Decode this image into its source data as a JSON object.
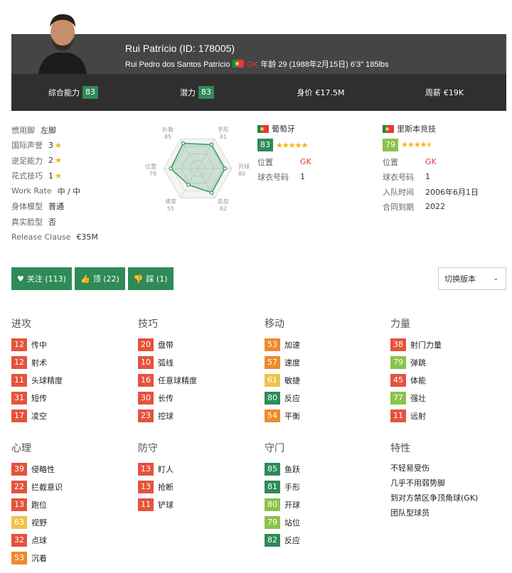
{
  "player": {
    "name": "Rui Patrício (ID: 178005)",
    "full_name": "Rui Pedro dos Santos Patrício",
    "position": "GK",
    "age_info": "年龄 29 (1988年2月15日) 6'3\" 185lbs"
  },
  "summary": [
    {
      "label": "综合能力",
      "value": "83"
    },
    {
      "label": "潜力",
      "value": "83"
    },
    {
      "label": "身价",
      "value": "€17.5M"
    },
    {
      "label": "周薪",
      "value": "€19K"
    }
  ],
  "info": [
    {
      "label": "惯用脚",
      "value": "左脚"
    },
    {
      "label": "国际声誉",
      "value": "3"
    },
    {
      "label": "逆足能力",
      "value": "2"
    },
    {
      "label": "花式技巧",
      "value": "1"
    },
    {
      "label": "Work Rate",
      "value": "中 / 中"
    },
    {
      "label": "身体模型",
      "value": "普通"
    },
    {
      "label": "真实脸型",
      "value": "否"
    },
    {
      "label": "Release Clause",
      "value": "€35M"
    }
  ],
  "radar": [
    {
      "label": "扑救",
      "value": "85"
    },
    {
      "label": "手形",
      "value": "81"
    },
    {
      "label": "开球",
      "value": "80"
    },
    {
      "label": "反应",
      "value": "82"
    },
    {
      "label": "速度",
      "value": "55"
    },
    {
      "label": "位置",
      "value": "79"
    }
  ],
  "national": {
    "name": "葡萄牙",
    "rating": "83",
    "stars": "★★★★★",
    "position_label": "位置",
    "position": "GK",
    "jersey_label": "球衣号码",
    "jersey": "1"
  },
  "club": {
    "name": "里斯本竞技",
    "rating": "79",
    "stars": "★★★★⯨",
    "position_label": "位置",
    "position": "GK",
    "jersey_label": "球衣号码",
    "jersey": "1",
    "joined_label": "入队时间",
    "joined": "2006年6月1日",
    "contract_label": "合同到期",
    "contract": "2022"
  },
  "buttons": {
    "follow": "关注 (113)",
    "like": "顶 (22)",
    "dislike": "踩 (1)",
    "version": "切换版本"
  },
  "attributes": [
    {
      "title": "进攻",
      "items": [
        {
          "v": "12",
          "n": "传中",
          "c": "r"
        },
        {
          "v": "12",
          "n": "射术",
          "c": "r"
        },
        {
          "v": "11",
          "n": "头球精度",
          "c": "r"
        },
        {
          "v": "31",
          "n": "短传",
          "c": "r"
        },
        {
          "v": "17",
          "n": "凌空",
          "c": "r"
        }
      ]
    },
    {
      "title": "技巧",
      "items": [
        {
          "v": "20",
          "n": "盘带",
          "c": "r"
        },
        {
          "v": "10",
          "n": "弧线",
          "c": "r"
        },
        {
          "v": "16",
          "n": "任意球精度",
          "c": "r"
        },
        {
          "v": "30",
          "n": "长传",
          "c": "r"
        },
        {
          "v": "23",
          "n": "控球",
          "c": "r"
        }
      ]
    },
    {
      "title": "移动",
      "items": [
        {
          "v": "53",
          "n": "加速",
          "c": "o"
        },
        {
          "v": "57",
          "n": "速度",
          "c": "o"
        },
        {
          "v": "61",
          "n": "敏捷",
          "c": "y"
        },
        {
          "v": "80",
          "n": "反应",
          "c": "g"
        },
        {
          "v": "54",
          "n": "平衡",
          "c": "o"
        }
      ]
    },
    {
      "title": "力量",
      "items": [
        {
          "v": "38",
          "n": "射门力量",
          "c": "r"
        },
        {
          "v": "79",
          "n": "弹跳",
          "c": "lg"
        },
        {
          "v": "45",
          "n": "体能",
          "c": "r"
        },
        {
          "v": "77",
          "n": "强壮",
          "c": "lg"
        },
        {
          "v": "11",
          "n": "远射",
          "c": "r"
        }
      ]
    },
    {
      "title": "心理",
      "items": [
        {
          "v": "39",
          "n": "侵略性",
          "c": "r"
        },
        {
          "v": "22",
          "n": "拦截意识",
          "c": "r"
        },
        {
          "v": "13",
          "n": "跑位",
          "c": "r"
        },
        {
          "v": "63",
          "n": "视野",
          "c": "y"
        },
        {
          "v": "32",
          "n": "点球",
          "c": "r"
        },
        {
          "v": "53",
          "n": "沉着",
          "c": "o"
        }
      ]
    },
    {
      "title": "防守",
      "items": [
        {
          "v": "13",
          "n": "盯人",
          "c": "r"
        },
        {
          "v": "13",
          "n": "抢断",
          "c": "r"
        },
        {
          "v": "11",
          "n": "铲球",
          "c": "r"
        }
      ]
    },
    {
      "title": "守门",
      "items": [
        {
          "v": "85",
          "n": "鱼跃",
          "c": "g"
        },
        {
          "v": "81",
          "n": "手形",
          "c": "g"
        },
        {
          "v": "80",
          "n": "开球",
          "c": "lg"
        },
        {
          "v": "79",
          "n": "站位",
          "c": "lg"
        },
        {
          "v": "82",
          "n": "反应",
          "c": "g"
        }
      ]
    }
  ],
  "traits": {
    "title": "特性",
    "items": [
      "不轻易受伤",
      "几乎不用弱势脚",
      "到对方禁区争顶角球(GK)",
      "团队型球员"
    ]
  },
  "colors": {
    "green": "#2e8b57",
    "light_green": "#8bc34a",
    "yellow": "#f0c24b",
    "orange": "#ef8a2b",
    "red": "#e5533d",
    "header": "#454545"
  }
}
